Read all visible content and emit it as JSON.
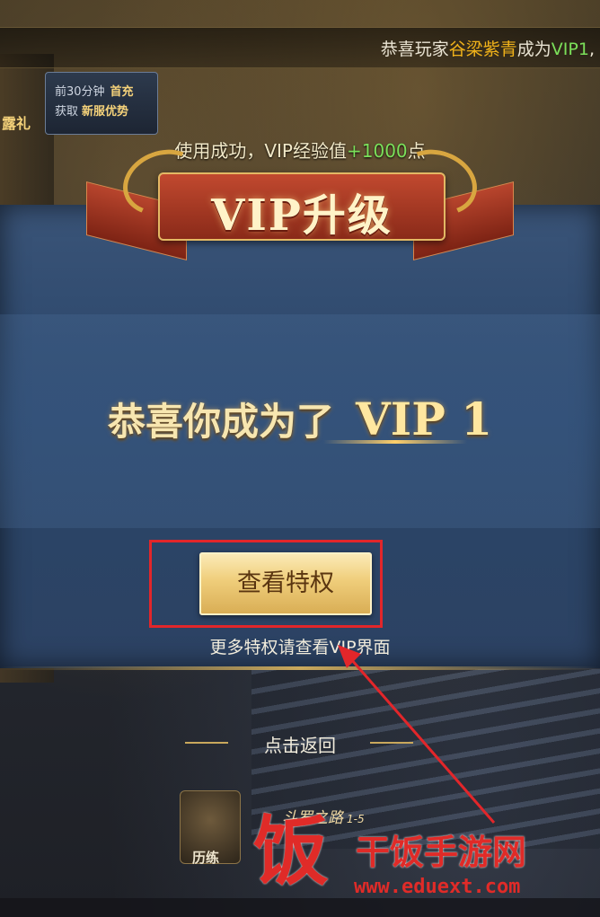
{
  "marquee": {
    "prefix": "恭喜玩家",
    "player_name": "谷梁紫青",
    "middle": "成为",
    "vip": "VIP1",
    "suffix": ","
  },
  "promo": {
    "line1_prefix": "前30分钟",
    "line1_bold": "首充",
    "line2_prefix": "获取",
    "line2_bold": "新服优势"
  },
  "side_gift": "露礼",
  "vip_upgrade": {
    "success_prefix": "使用成功，VIP经验值",
    "success_amount": "+1000",
    "success_suffix": "点",
    "banner_title": "VIP升级",
    "congrats_text": "恭喜你成为了",
    "vip_level": "VIP 1",
    "privilege_button": "查看特权",
    "hint": "更多特权请查看VIP界面",
    "back_label": "点击返回"
  },
  "game_ui": {
    "train_label": "历练",
    "road_label": "斗罗之路",
    "road_stage": "1-5"
  },
  "watermark": {
    "logo_char": "饭",
    "title": "干饭手游网",
    "url": "www.eduext.com"
  },
  "colors": {
    "highlight_box": "#e2262a",
    "player_name": "#f0b21a",
    "vip_green": "#7be05a",
    "button_gold": "#efcd7a"
  }
}
